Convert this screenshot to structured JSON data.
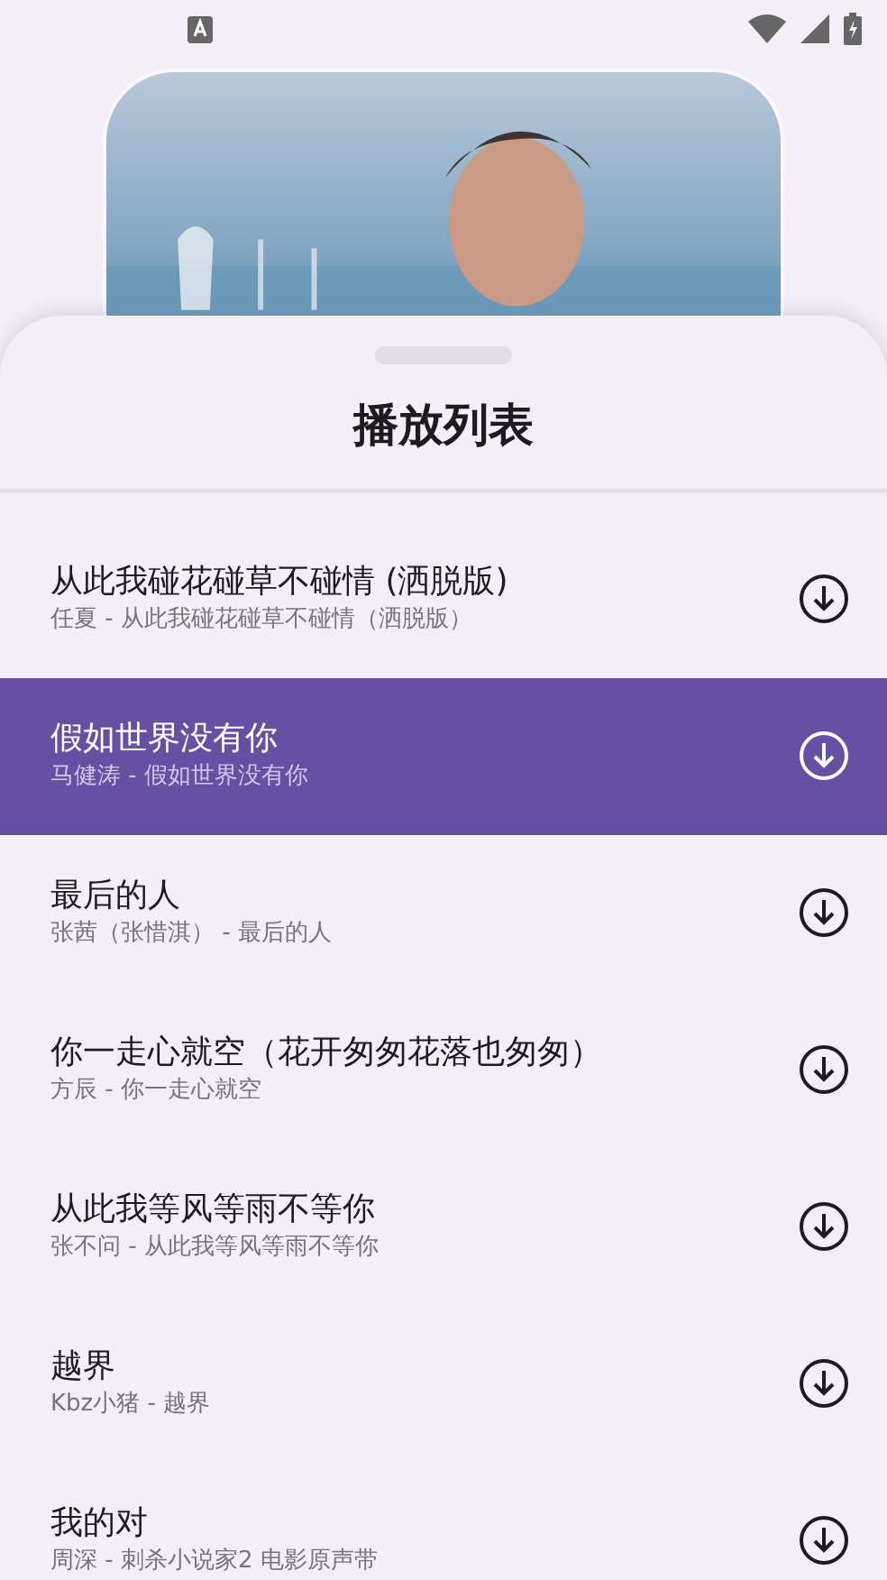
{
  "sheet": {
    "title": "播放列表"
  },
  "songs": [
    {
      "title": "从此我碰花碰草不碰情 (洒脱版)",
      "subtitle": "任夏 - 从此我碰花碰草不碰情（洒脱版）",
      "selected": false
    },
    {
      "title": "假如世界没有你",
      "subtitle": "马健涛 - 假如世界没有你",
      "selected": true
    },
    {
      "title": "最后的人",
      "subtitle": "张茜（张惜淇） - 最后的人",
      "selected": false
    },
    {
      "title": "你一走心就空（花开匆匆花落也匆匆）",
      "subtitle": "方辰 - 你一走心就空",
      "selected": false
    },
    {
      "title": "从此我等风等雨不等你",
      "subtitle": "张不问 - 从此我等风等雨不等你",
      "selected": false
    },
    {
      "title": "越界",
      "subtitle": "Kbz小猪 - 越界",
      "selected": false
    },
    {
      "title": "我的对",
      "subtitle": "周深 - 刺杀小说家2 电影原声带",
      "selected": false
    }
  ]
}
